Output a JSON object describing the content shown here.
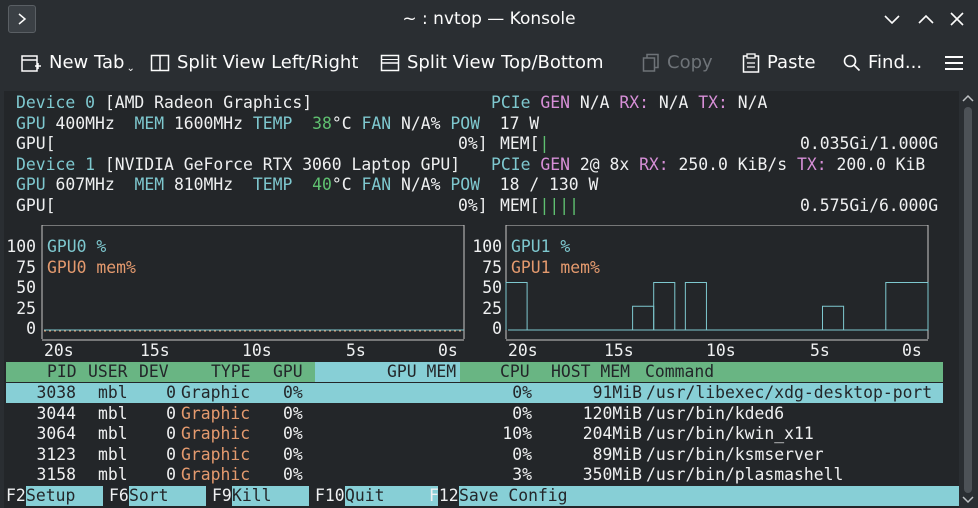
{
  "window": {
    "title": "~ : nvtop — Konsole"
  },
  "toolbar": {
    "new_tab": "New Tab",
    "split_lr": "Split View Left/Right",
    "split_tb": "Split View Top/Bottom",
    "copy": "Copy",
    "paste": "Paste",
    "find": "Find..."
  },
  "devices": [
    {
      "label": "Device 0",
      "name": "[AMD Radeon Graphics]",
      "pcie": "PCIe",
      "gen_label": "GEN",
      "gen": "N/A",
      "rx_label": "RX:",
      "rx": "N/A",
      "tx_label": "TX:",
      "tx": "N/A",
      "gpu_label": "GPU",
      "gpu_clock": "400MHz",
      "mem_label": "MEM",
      "mem_clock": "1600MHz",
      "temp_label": "TEMP",
      "temp": "38",
      "temp_unit": "°C",
      "fan_label": "FAN",
      "fan": "N/A%",
      "pow_label": "POW",
      "pow": "17 W",
      "gpu_bar": "GPU[",
      "gpu_pct": "0%]",
      "mem_bar": "MEM[",
      "mem_bar_fill": "|",
      "mem_usage": "0.035Gi/1.000G"
    },
    {
      "label": "Device 1",
      "name": "[NVIDIA GeForce RTX 3060 Laptop GPU]",
      "pcie": "PCIe",
      "gen_label": "GEN",
      "gen": "2@ 8x",
      "rx_label": "RX:",
      "rx": "250.0 KiB/s",
      "tx_label": "TX:",
      "tx": "200.0 KiB",
      "gpu_label": "GPU",
      "gpu_clock": "607MHz",
      "mem_label": "MEM",
      "mem_clock": "810MHz",
      "temp_label": "TEMP",
      "temp": "40",
      "temp_unit": "°C",
      "fan_label": "FAN",
      "fan": "N/A%",
      "pow_label": "POW",
      "pow": "18 / 130 W",
      "gpu_bar": "GPU[",
      "gpu_pct": "0%]",
      "mem_bar": "MEM[",
      "mem_bar_fill": "||||",
      "mem_usage": "0.575Gi/6.000G"
    }
  ],
  "charts": [
    {
      "legend_util": "GPU0 %",
      "legend_mem": "GPU0 mem%",
      "y_ticks": [
        "100",
        "75",
        "50",
        "25",
        "0"
      ],
      "x_ticks": [
        "20s",
        "15s",
        "10s",
        "5s",
        "0s"
      ]
    },
    {
      "legend_util": "GPU1 %",
      "legend_mem": "GPU1 mem%",
      "y_ticks": [
        "100",
        "75",
        "50",
        "25",
        "0"
      ],
      "x_ticks": [
        "20s",
        "15s",
        "10s",
        "5s",
        "0s"
      ]
    }
  ],
  "chart_data": [
    {
      "type": "line",
      "x": [
        -20,
        -18,
        -16,
        -14,
        -12,
        -10,
        -8,
        -6,
        -4,
        -2,
        0
      ],
      "series": [
        {
          "name": "GPU0 %",
          "values": [
            0,
            0,
            0,
            0,
            0,
            0,
            0,
            0,
            0,
            0,
            0
          ]
        },
        {
          "name": "GPU0 mem%",
          "values": [
            0,
            0,
            0,
            0,
            0,
            0,
            0,
            0,
            0,
            0,
            0
          ]
        }
      ],
      "ylim": [
        0,
        100
      ],
      "color_util": "#7ec8cf",
      "color_mem": "#e49a6e"
    },
    {
      "type": "line",
      "segments": [
        {
          "from": -20.0,
          "to": -19.0,
          "value": 50
        },
        {
          "from": -14.0,
          "to": -13.0,
          "value": 25
        },
        {
          "from": -13.0,
          "to": -12.0,
          "value": 50
        },
        {
          "from": -11.5,
          "to": -10.5,
          "value": 50
        },
        {
          "from": -5.0,
          "to": -4.0,
          "value": 25
        },
        {
          "from": -2.0,
          "to": 0.0,
          "value": 50
        }
      ],
      "series": [
        {
          "name": "GPU1 %",
          "values": [
            50,
            0,
            0,
            0,
            25,
            50,
            50,
            0,
            25,
            0,
            50
          ]
        }
      ],
      "ylim": [
        0,
        100
      ],
      "color_util": "#7ec8cf"
    }
  ],
  "process_table": {
    "columns": [
      "PID",
      "USER",
      "DEV",
      "TYPE",
      "GPU",
      "GPU MEM",
      "CPU",
      "HOST MEM",
      "Command"
    ],
    "rows": [
      {
        "pid": "3038",
        "user": "mbl",
        "dev": "0",
        "type": "Graphic",
        "gpu": "0%",
        "gpu_mem": "",
        "cpu": "0%",
        "host_mem": "91MiB",
        "command": "/usr/libexec/xdg-desktop-port"
      },
      {
        "pid": "3044",
        "user": "mbl",
        "dev": "0",
        "type": "Graphic",
        "gpu": "0%",
        "gpu_mem": "",
        "cpu": "0%",
        "host_mem": "120MiB",
        "command": "/usr/bin/kded6"
      },
      {
        "pid": "3064",
        "user": "mbl",
        "dev": "0",
        "type": "Graphic",
        "gpu": "0%",
        "gpu_mem": "",
        "cpu": "10%",
        "host_mem": "204MiB",
        "command": "/usr/bin/kwin_x11"
      },
      {
        "pid": "3123",
        "user": "mbl",
        "dev": "0",
        "type": "Graphic",
        "gpu": "0%",
        "gpu_mem": "",
        "cpu": "0%",
        "host_mem": "89MiB",
        "command": "/usr/bin/ksmserver"
      },
      {
        "pid": "3158",
        "user": "mbl",
        "dev": "0",
        "type": "Graphic",
        "gpu": "0%",
        "gpu_mem": "",
        "cpu": "3%",
        "host_mem": "350MiB",
        "command": "/usr/bin/plasmashell"
      }
    ]
  },
  "footer": {
    "keys": [
      {
        "key": "F2",
        "label": "Setup"
      },
      {
        "key": "F6",
        "label": "Sort"
      },
      {
        "key": "F9",
        "label": "Kill"
      },
      {
        "key": "F10",
        "label": "Quit"
      },
      {
        "key": "F12",
        "label": "Save Config"
      }
    ]
  },
  "colors": {
    "cyan": "#7ec8cf",
    "magenta": "#d78fd7",
    "green": "#5fc070",
    "orange": "#e49a6e",
    "header_green": "#69b583",
    "highlight_cyan": "#87cfd6"
  }
}
